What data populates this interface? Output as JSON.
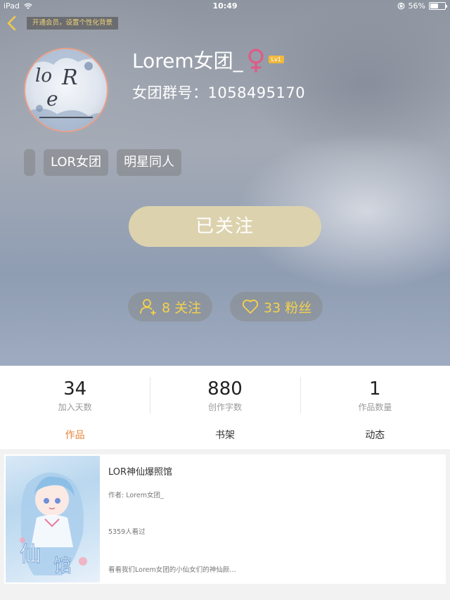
{
  "status_bar": {
    "device": "iPad",
    "time": "10:49",
    "battery": "56%",
    "battery_level": 0.56
  },
  "header": {
    "vip_banner": "开通会员，设置个性化背景"
  },
  "profile": {
    "username": "Lorem女团_",
    "level": "Lv1",
    "group_id": "女团群号：1058495170",
    "tags": [
      "",
      "LOR女团",
      "明星同人"
    ]
  },
  "follow_button": "已关注",
  "social": {
    "following": "8 关注",
    "fans": "33 粉丝"
  },
  "stats": [
    {
      "value": "34",
      "label": "加入天数"
    },
    {
      "value": "880",
      "label": "创作字数"
    },
    {
      "value": "1",
      "label": "作品数量"
    }
  ],
  "tabs": [
    "作品",
    "书架",
    "动态"
  ],
  "active_tab": 0,
  "work": {
    "title": "LOR神仙爆照馆",
    "author": "作者: Lorem女团_",
    "views": "5359人看过",
    "description": "看看我们Lorem女团的小仙女们的神仙颜…"
  },
  "colors": {
    "accent": "#e8833a",
    "follow_bg": "#dcd2ae",
    "stat_text": "#f5d24a",
    "female": "#e05a86"
  }
}
